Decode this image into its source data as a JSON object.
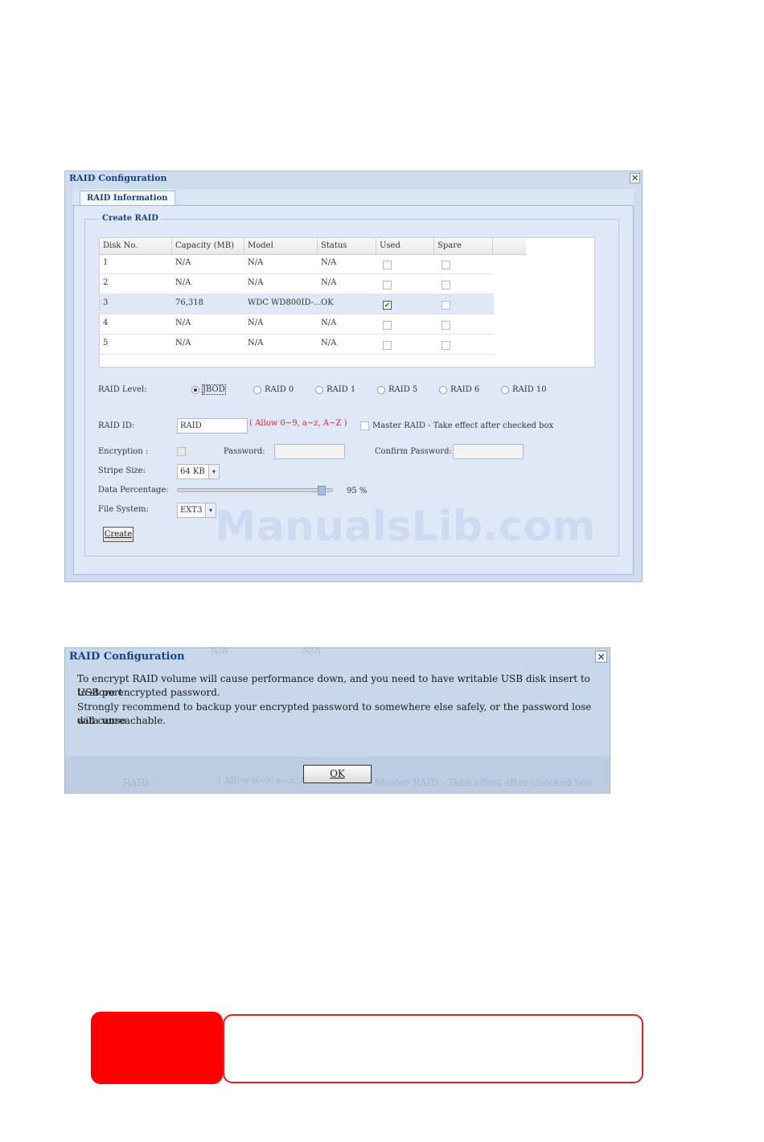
{
  "raid_window": {
    "title": "RAID Configuration",
    "close_glyph": "✕",
    "tab": "RAID Information",
    "fieldset_legend": "Create RAID",
    "columns": [
      "Disk No.",
      "Capacity (MB)",
      "Model",
      "Status",
      "Used",
      "Spare"
    ],
    "rows": [
      {
        "disk": "1",
        "capacity": "N/A",
        "model": "N/A",
        "status": "N/A",
        "used": false,
        "spare": false
      },
      {
        "disk": "2",
        "capacity": "N/A",
        "model": "N/A",
        "status": "N/A",
        "used": false,
        "spare": false
      },
      {
        "disk": "3",
        "capacity": "76,318",
        "model": "WDC WD800ID-...",
        "status": "OK",
        "used": true,
        "spare": false
      },
      {
        "disk": "4",
        "capacity": "N/A",
        "model": "N/A",
        "status": "N/A",
        "used": false,
        "spare": false
      },
      {
        "disk": "5",
        "capacity": "N/A",
        "model": "N/A",
        "status": "N/A",
        "used": false,
        "spare": false
      }
    ],
    "raid_level_label": "RAID Level:",
    "raid_levels": [
      "JBOD",
      "RAID 0",
      "RAID 1",
      "RAID 5",
      "RAID 6",
      "RAID 10"
    ],
    "raid_level_selected": "JBOD",
    "raid_id_label": "RAID ID:",
    "raid_id_value": "RAID",
    "raid_id_hint": "( Allow 0~9, a~z, A~Z )",
    "master_raid_label": "Master RAID - Take effect after checked box",
    "encryption_label": "Encryption :",
    "password_label": "Password:",
    "confirm_password_label": "Confirm Password:",
    "stripe_size_label": "Stripe Size:",
    "stripe_size_value": "64 KB",
    "data_percentage_label": "Data Percentage:",
    "data_percentage_value": "95 %",
    "data_percentage_fraction": 0.95,
    "file_system_label": "File System:",
    "file_system_value": "EXT3",
    "create_button": "Create",
    "combo_glyph": "▾",
    "check_glyph": "✔"
  },
  "watermark": "ManualsLib.com",
  "dialog": {
    "title": "RAID Configuration",
    "close_glyph": "✕",
    "line1": "To encrypt RAID volume will cause performance down, and you need to have writable USB disk insert to USB port",
    "line2": "to store encrypted password.",
    "line3": "Strongly recommend to backup your encrypted password to somewhere else safely, or the password lose will cause",
    "line4": "data unreachable.",
    "ok_button": "OK",
    "ghost_raid": "RAID",
    "ghost_hint": "( Allow 0~9, a~z, A~Z )",
    "ghost_master": "Master RAID - Take effect after checked box",
    "ghost_top_1": "N/A",
    "ghost_top_2": "N/A"
  },
  "colors": {
    "note_red": "#ff0000",
    "hint_red": "#d9232f",
    "title_blue": "#15428b"
  }
}
